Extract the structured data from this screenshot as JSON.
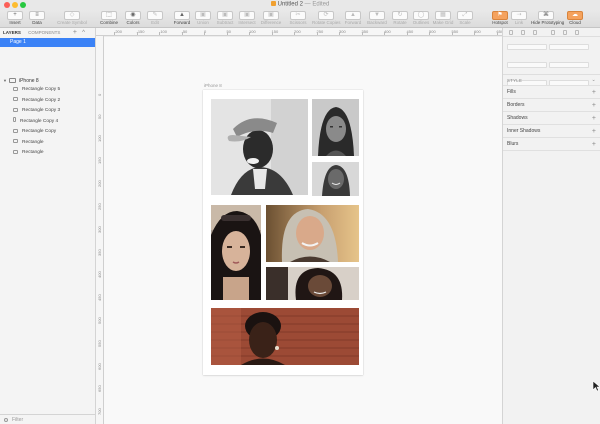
{
  "window": {
    "title": "Untitled 2",
    "status": "— Edited"
  },
  "toolbar": {
    "items": [
      {
        "label": "Insert",
        "icon": "+"
      },
      {
        "label": "Data",
        "icon": "≡"
      },
      {
        "label": "Create Symbol",
        "icon": "◇"
      },
      {
        "label": "Combine",
        "icon": "⬚"
      },
      {
        "label": "Colors",
        "icon": "◉"
      },
      {
        "label": "Edit",
        "icon": "✎"
      },
      {
        "label": "Forward",
        "icon": "▲"
      },
      {
        "label": "Union",
        "icon": "▣"
      },
      {
        "label": "Subtract",
        "icon": "▣"
      },
      {
        "label": "Intersect",
        "icon": "▣"
      },
      {
        "label": "Difference",
        "icon": "▣"
      },
      {
        "label": "Scissors",
        "icon": "✂"
      },
      {
        "label": "Rotate Copies",
        "icon": "⟳"
      },
      {
        "label": "Forward",
        "icon": "▲"
      },
      {
        "label": "Backward",
        "icon": "▼"
      },
      {
        "label": "Rotate",
        "icon": "↻"
      },
      {
        "label": "Outlines",
        "icon": "◯"
      },
      {
        "label": "Make Grid",
        "icon": "▦"
      },
      {
        "label": "Scale",
        "icon": "⤢"
      },
      {
        "label": "Hotspot",
        "icon": "⚑"
      },
      {
        "label": "Link",
        "icon": "⇢"
      },
      {
        "label": "Hide Prototyping",
        "icon": "⌘"
      },
      {
        "label": "Cloud",
        "icon": "☁"
      }
    ]
  },
  "left_panel": {
    "tabs": [
      "LAYERS",
      "COMPONENTS"
    ],
    "page": "Page 1",
    "artboard": "iPhone 8",
    "layers": [
      "Rectangle Copy 5",
      "Rectangle Copy 2",
      "Rectangle Copy 3",
      "Rectangle Copy 4",
      "Rectangle Copy",
      "Rectangle",
      "Rectangle"
    ],
    "filter_placeholder": "Filter"
  },
  "ruler": {
    "top": [
      "-200",
      "-150",
      "-100",
      "-50",
      "0",
      "50",
      "100",
      "150",
      "200",
      "250",
      "300",
      "350",
      "400",
      "450",
      "500",
      "550",
      "600",
      "650"
    ],
    "left": [
      "0",
      "50",
      "100",
      "150",
      "200",
      "250",
      "300",
      "350",
      "400",
      "450",
      "500",
      "550",
      "600",
      "650",
      "700",
      "750"
    ]
  },
  "canvas": {
    "artboard_label": "iPhone 8"
  },
  "right_panel": {
    "style_label": "STYLE",
    "sections": [
      "Fills",
      "Borders",
      "Shadows",
      "Inner Shadows",
      "Blurs"
    ]
  },
  "icons": {
    "add": "+",
    "collapse": "^",
    "chevron": "⌄",
    "expand": "▼"
  },
  "colors": {
    "accent": "#3b82f6"
  }
}
